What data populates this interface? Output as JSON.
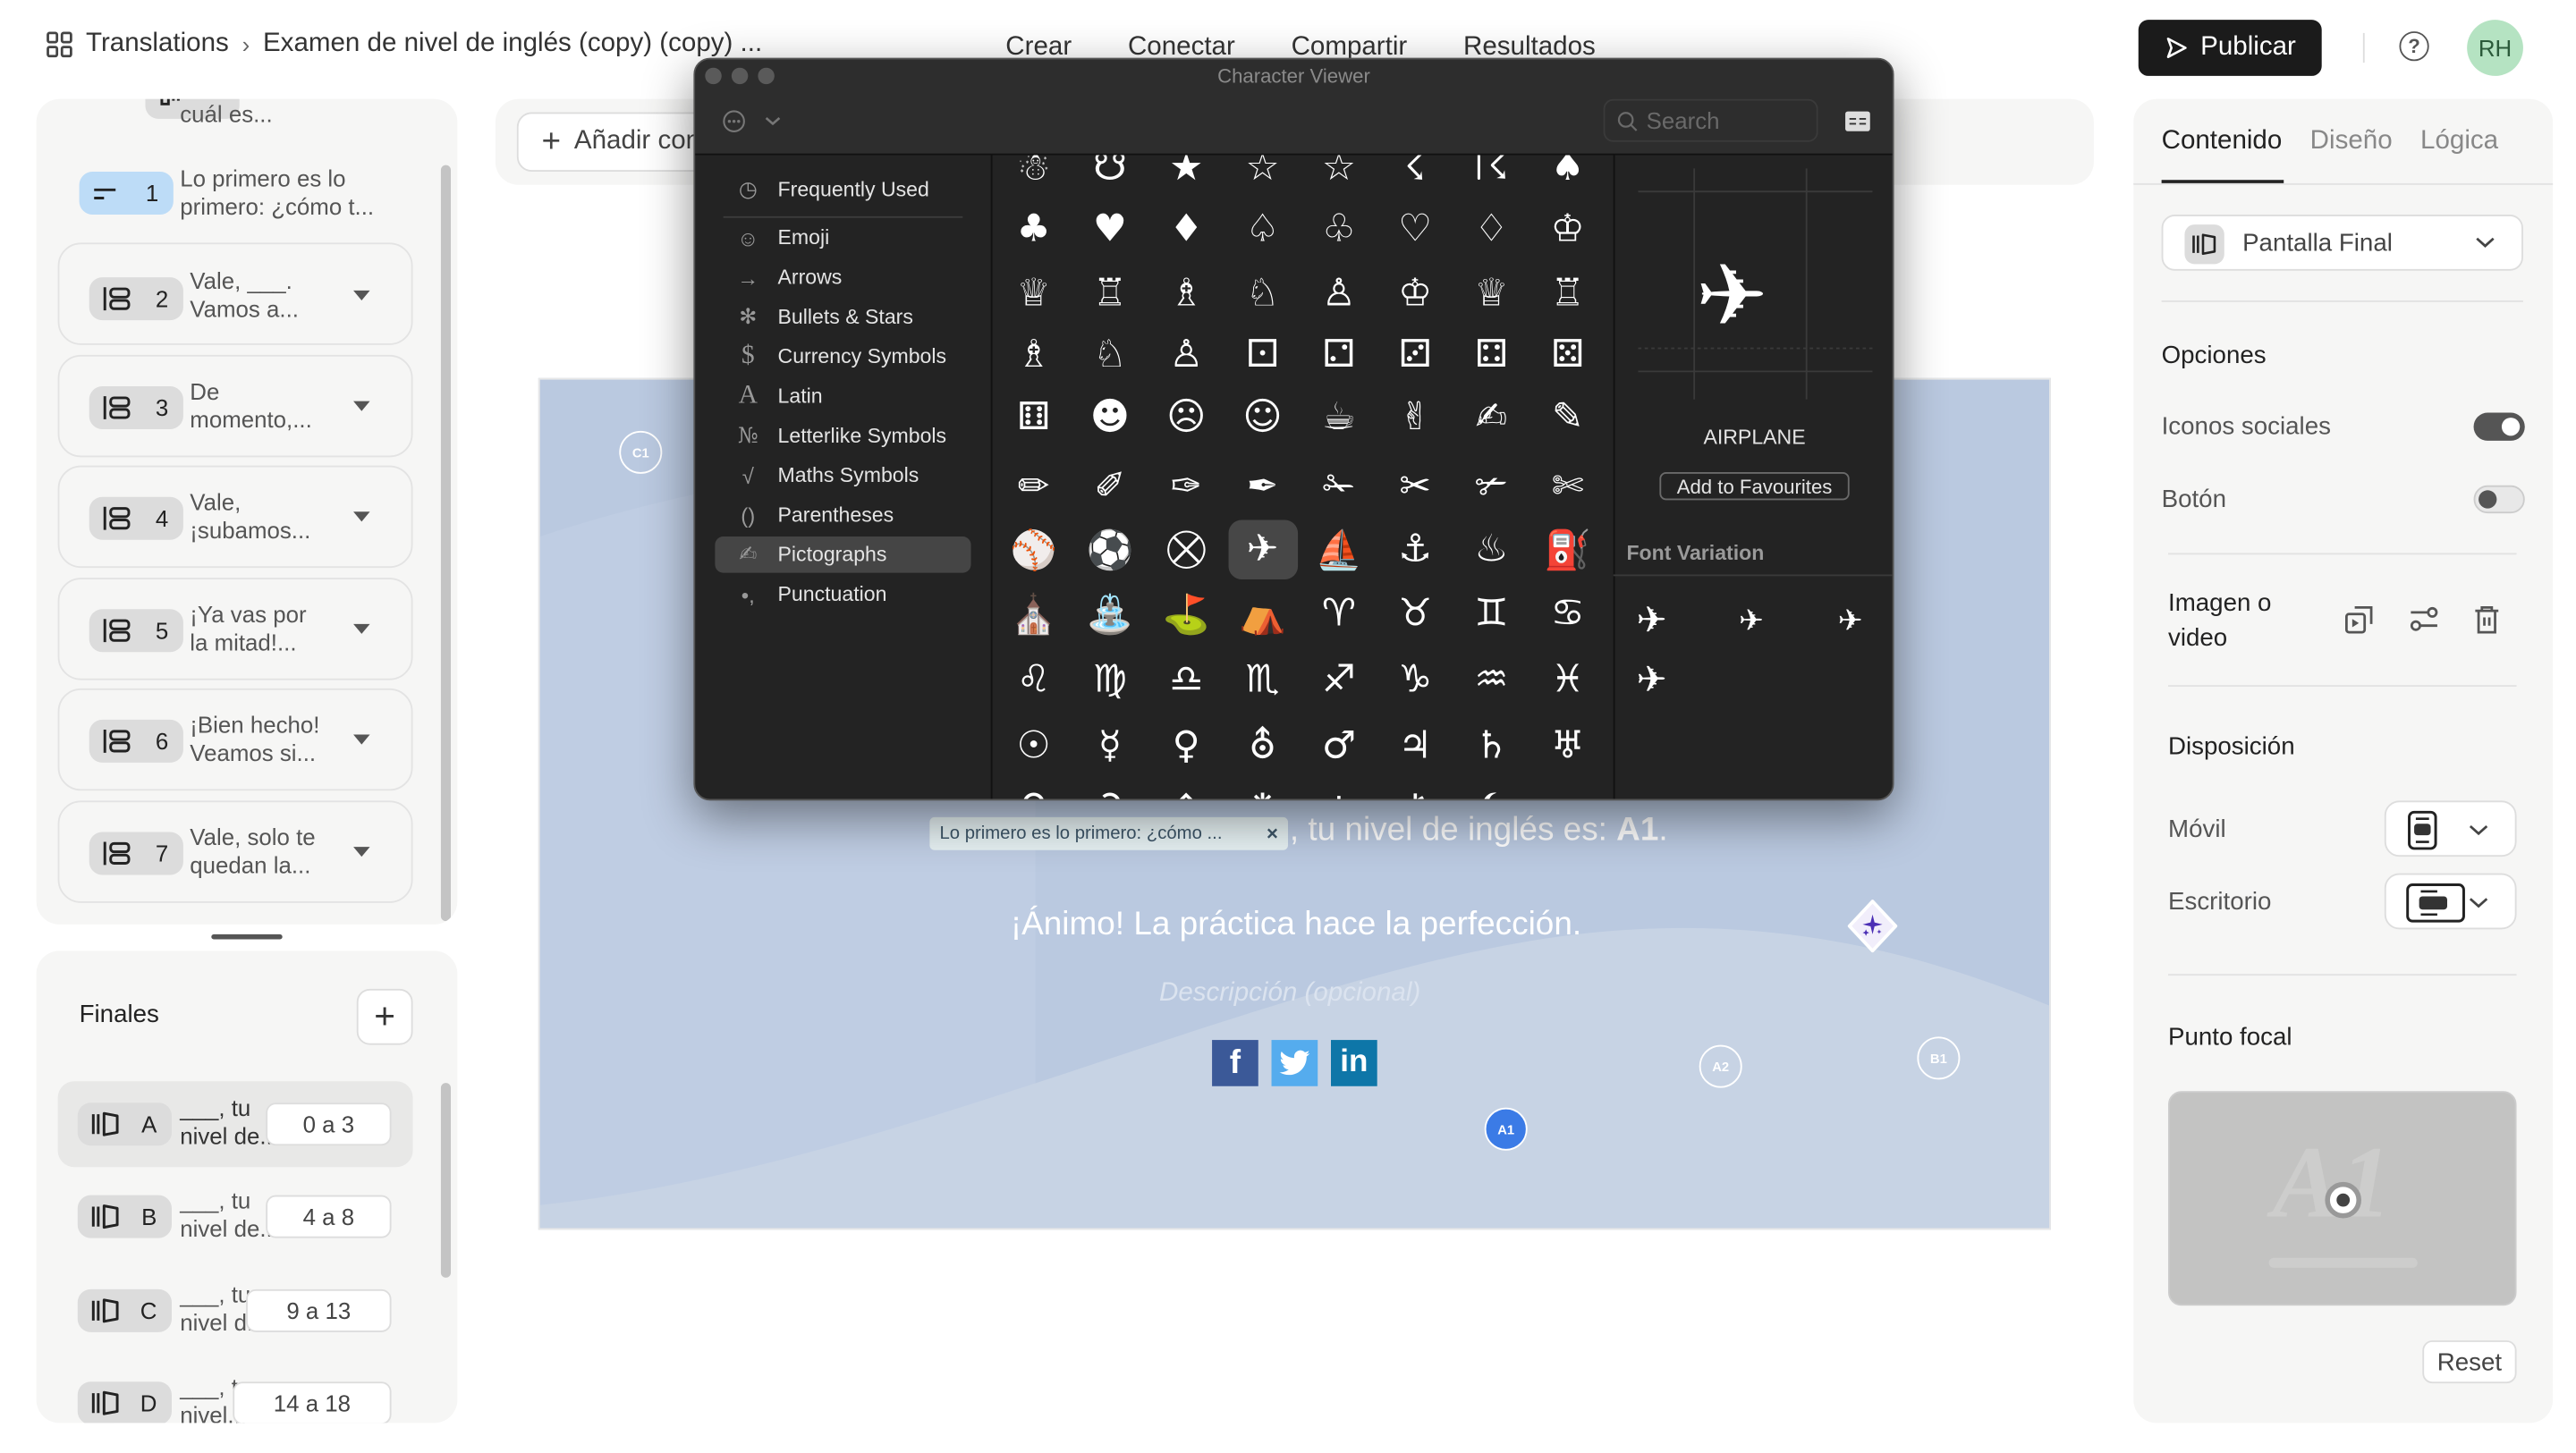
{
  "header": {
    "breadcrumb": {
      "root": "Translations",
      "separator": "›",
      "current": "Examen de nivel de inglés (copy) (copy) ..."
    },
    "nav_tabs": [
      "Crear",
      "Conectar",
      "Compartir",
      "Resultados"
    ],
    "publish_label": "Publicar",
    "help_glyph": "?",
    "avatar_initials": "RH"
  },
  "questions": {
    "items": [
      {
        "number": "",
        "text": "cuál es...",
        "icon": "welcome-screen-icon",
        "style": "plain"
      },
      {
        "number": "1",
        "text": "Lo primero es lo primero: ¿cómo t...",
        "icon": "short-text-icon",
        "style": "highlighted"
      },
      {
        "number": "2",
        "text": "Vale, ___. Vamos a...",
        "icon": "question-group-icon",
        "style": "card"
      },
      {
        "number": "3",
        "text": "De momento,...",
        "icon": "question-group-icon",
        "style": "card"
      },
      {
        "number": "4",
        "text": "Vale, ¡subamos...",
        "icon": "question-group-icon",
        "style": "card"
      },
      {
        "number": "5",
        "text": "¡Ya vas por la mitad!...",
        "icon": "question-group-icon",
        "style": "card"
      },
      {
        "number": "6",
        "text": "¡Bien hecho! Veamos si...",
        "icon": "question-group-icon",
        "style": "card"
      },
      {
        "number": "7",
        "text": "Vale, solo te quedan la...",
        "icon": "question-group-icon",
        "style": "card"
      }
    ]
  },
  "endings": {
    "title": "Finales",
    "add_label": "+",
    "items": [
      {
        "letter": "A",
        "text": "___, tu nivel de...",
        "range": "0 a 3",
        "selected": true
      },
      {
        "letter": "B",
        "text": "___, tu nivel de...",
        "range": "4 a 8",
        "selected": false
      },
      {
        "letter": "C",
        "text": "___, tu nivel d...",
        "range": "9 a 13",
        "selected": false
      },
      {
        "letter": "D",
        "text": "___, tu nivel...",
        "range": "14 a 18",
        "selected": false
      }
    ]
  },
  "canvas": {
    "add_content_label": "Añadir contenido",
    "recall_pill": "Lo primero es lo primero: ¿cómo ...",
    "recall_close": "×",
    "headline_prefix": ", tu nivel de inglés es: ",
    "headline_level": "A1",
    "headline_suffix": ".",
    "subtitle": "¡Ánimo! La práctica hace la perfección.",
    "description_placeholder": "Descripción (opcional)",
    "social": [
      "Facebook",
      "Twitter",
      "LinkedIn"
    ],
    "social_glyphs": [
      "f",
      "t",
      "in"
    ],
    "markers": [
      {
        "label": "C1",
        "active": false
      },
      {
        "label": "A1",
        "active": true
      },
      {
        "label": "A2",
        "active": false
      },
      {
        "label": "B1",
        "active": false
      }
    ]
  },
  "right_panel": {
    "tabs": [
      "Contenido",
      "Diseño",
      "Lógica"
    ],
    "active_tab": "Contenido",
    "type_select": "Pantalla Final",
    "options_title": "Opciones",
    "social_icons_label": "Iconos sociales",
    "social_icons_on": true,
    "button_label": "Botón",
    "button_on": false,
    "media_title": "Imagen o video",
    "layout_title": "Disposición",
    "mobile_label": "Móvil",
    "desktop_label": "Escritorio",
    "focal_title": "Punto focal",
    "focal_image_text": "A1",
    "reset_label": "Reset"
  },
  "character_viewer": {
    "title": "Character Viewer",
    "search_placeholder": "Search",
    "categories": [
      {
        "label": "Frequently Used",
        "glyph": "◷"
      },
      {
        "label": "Emoji",
        "glyph": "☺"
      },
      {
        "label": "Arrows",
        "glyph": "→"
      },
      {
        "label": "Bullets & Stars",
        "glyph": "✻"
      },
      {
        "label": "Currency Symbols",
        "glyph": "$"
      },
      {
        "label": "Latin",
        "glyph": "A"
      },
      {
        "label": "Letterlike Symbols",
        "glyph": "№"
      },
      {
        "label": "Maths Symbols",
        "glyph": "√"
      },
      {
        "label": "Parentheses",
        "glyph": "()"
      },
      {
        "label": "Pictographs",
        "glyph": "✍"
      },
      {
        "label": "Punctuation",
        "glyph": "•,"
      }
    ],
    "selected_category": "Pictographs",
    "glyph_rows": [
      [
        "☃",
        "☋",
        "★",
        "☆",
        "☆",
        "☇",
        "☈",
        "♠"
      ],
      [
        "♣",
        "♥",
        "♦",
        "♤",
        "♧",
        "♡",
        "♢",
        "♔"
      ],
      [
        "♕",
        "♖",
        "♗",
        "♘",
        "♙",
        "♔",
        "♕",
        "♖"
      ],
      [
        "♗",
        "♘",
        "♙",
        "⚀",
        "⚁",
        "⚂",
        "⚃",
        "⚄"
      ],
      [
        "⚅",
        "☻",
        "☹",
        "☺",
        "☕",
        "✌",
        "✍",
        "✎"
      ],
      [
        "✏",
        "✐",
        "✑",
        "✒",
        "✁",
        "✂",
        "✃",
        "✄"
      ],
      [
        "⚾",
        "⚽",
        "⛒",
        "✈",
        "⛵",
        "⚓",
        "♨",
        "⛽"
      ],
      [
        "⛪",
        "⛲",
        "⛳",
        "⛺",
        "♈",
        "♉",
        "♊",
        "♋"
      ],
      [
        "♌",
        "♍",
        "♎",
        "♏",
        "♐",
        "♑",
        "♒",
        "♓"
      ],
      [
        "☉",
        "☿",
        "♀",
        "⛢",
        "♂",
        "♃",
        "♄",
        "♅"
      ],
      [
        "⚲",
        "⚳",
        "⚴",
        "⚵",
        "⚶",
        "⚷",
        "⚸",
        "⚹"
      ]
    ],
    "selected_glyph": "✈",
    "selected_name": "AIRPLANE",
    "add_favourites_label": "Add to Favourites",
    "font_variation_title": "Font Variation",
    "variations": [
      "✈",
      "✈",
      "✈",
      "✈"
    ]
  },
  "colors": {
    "publish_bg": "#1b1b1b",
    "avatar_bg": "#b5e3c2",
    "canvas_bg": "#bac9e0",
    "active_marker": "#3b7be6",
    "highlight_chip": "#bddcf7",
    "facebook": "#3b5998",
    "twitter": "#55acee",
    "linkedin": "#0e76a8",
    "ai_accent": "#4b2fb5"
  }
}
